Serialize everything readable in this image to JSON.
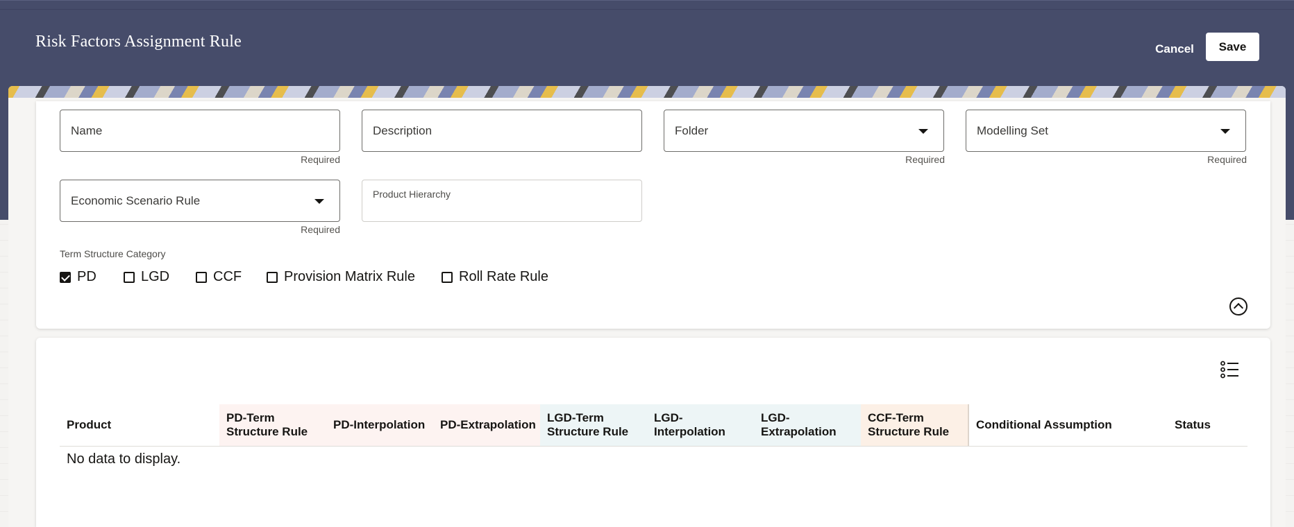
{
  "header": {
    "title": "Risk Factors Assignment Rule",
    "cancel_label": "Cancel",
    "save_label": "Save"
  },
  "form": {
    "name": {
      "label": "Name",
      "required": "Required"
    },
    "description": {
      "label": "Description"
    },
    "folder": {
      "label": "Folder",
      "required": "Required"
    },
    "modelling_set": {
      "label": "Modelling Set",
      "required": "Required"
    },
    "economic_scenario_rule": {
      "label": "Economic Scenario Rule",
      "required": "Required"
    },
    "product_hierarchy": {
      "label": "Product Hierarchy"
    },
    "term_structure": {
      "label": "Term Structure Category",
      "options": [
        {
          "label": "PD",
          "checked": true
        },
        {
          "label": "LGD",
          "checked": false
        },
        {
          "label": "CCF",
          "checked": false
        },
        {
          "label": "Provision Matrix Rule",
          "checked": false
        },
        {
          "label": "Roll Rate Rule",
          "checked": false
        }
      ]
    }
  },
  "table": {
    "columns": [
      "Product",
      "PD-Term Structure Rule",
      "PD-Interpolation",
      "PD-Extrapolation",
      "LGD-Term Structure Rule",
      "LGD-Interpolation",
      "LGD-Extrapolation",
      "CCF-Term Structure Rule",
      "Conditional Assumption",
      "Status"
    ],
    "empty_message": "No data to display."
  },
  "colors": {
    "header_bg": "#464c6a",
    "pd_col_bg": "#fdf3f1",
    "lgd_col_bg": "#edf5f6",
    "ccf_col_bg": "#fcf0e6"
  },
  "icons": [
    "chevron-down-icon",
    "collapse-up-icon",
    "column-list-icon",
    "checkmark-icon"
  ]
}
